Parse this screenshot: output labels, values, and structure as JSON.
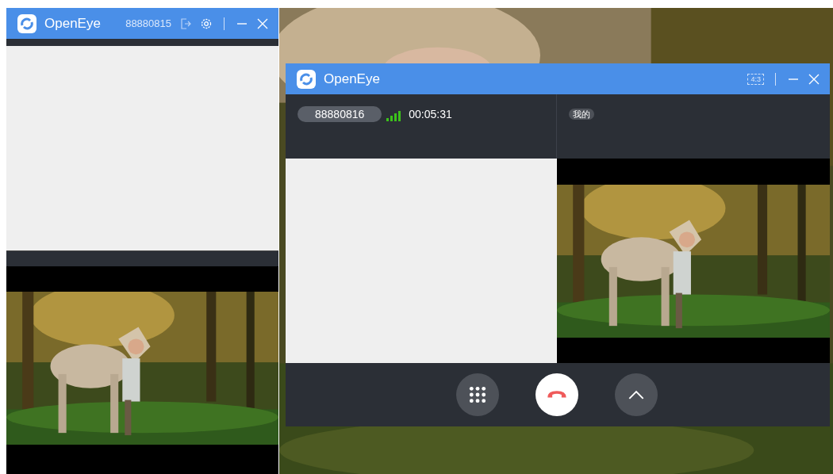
{
  "main_window": {
    "title": "OpenEye",
    "number": "88880815"
  },
  "call_window": {
    "title": "OpenEye",
    "aspect_button": "4:3",
    "caller": {
      "number": "88880816",
      "duration": "00:05:31"
    },
    "local_label": "我的",
    "controls": [
      {
        "kind": "keypad"
      },
      {
        "kind": "hangup"
      },
      {
        "kind": "expand"
      }
    ]
  }
}
